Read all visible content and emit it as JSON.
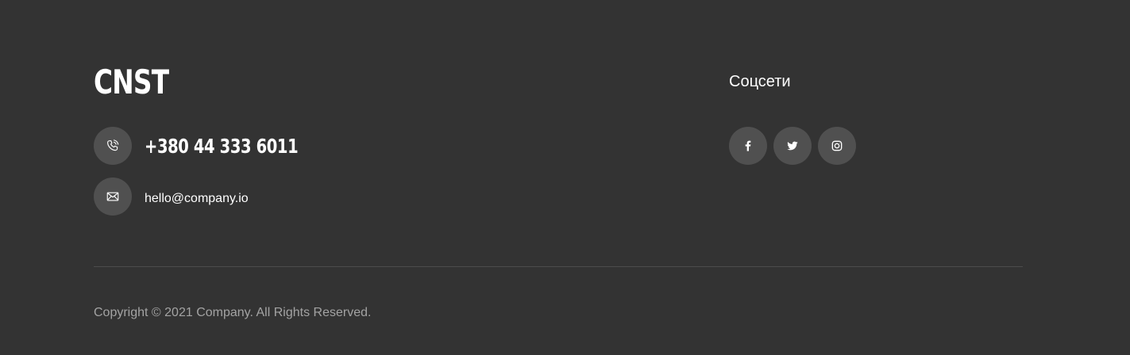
{
  "brand": {
    "logo_text": "CNST"
  },
  "contacts": {
    "phone": "+380 44 333 6011",
    "email": "hello@company.io",
    "phone_icon": "phone-icon",
    "email_icon": "envelope-icon"
  },
  "social": {
    "title": "Соцсети",
    "items": [
      {
        "icon": "facebook-icon"
      },
      {
        "icon": "twitter-icon"
      },
      {
        "icon": "instagram-icon"
      }
    ]
  },
  "footer": {
    "copyright": "Copyright © 2021 Company. All Rights Reserved."
  },
  "colors": {
    "background": "#333333",
    "icon_circle": "#505050",
    "text": "#ffffff",
    "muted_text": "#a3a3a3",
    "divider": "#4c4c4c"
  }
}
